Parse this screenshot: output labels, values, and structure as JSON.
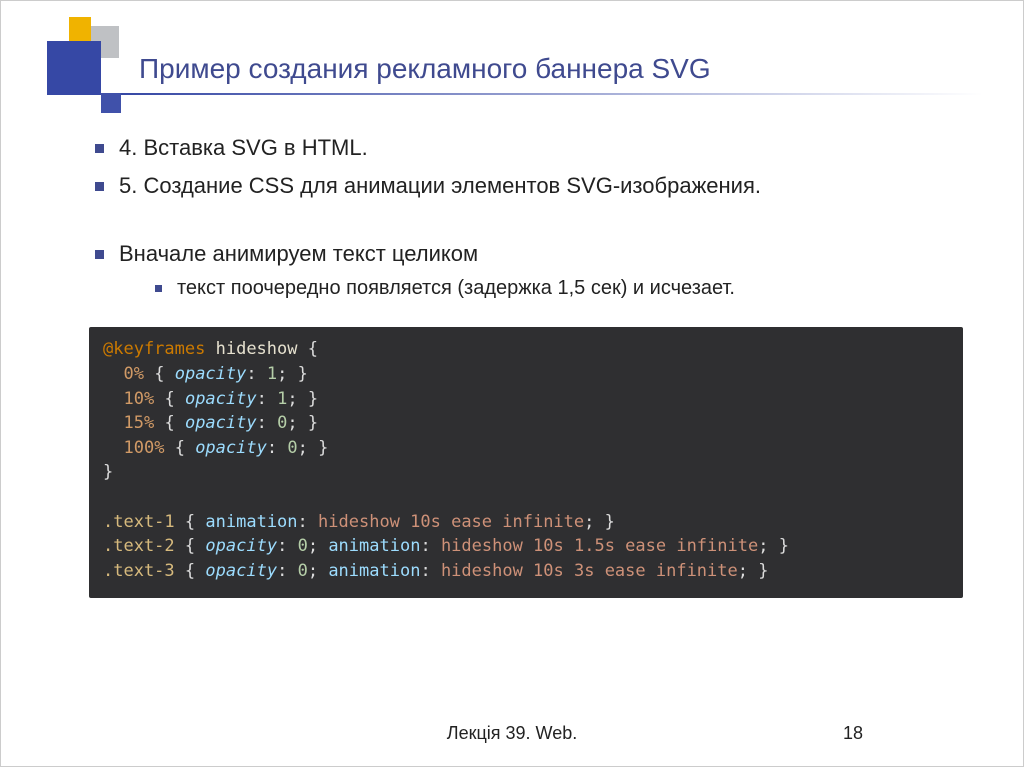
{
  "title": "Пример создания рекламного баннера SVG",
  "bullets": {
    "b1": "4. Вставка SVG в HTML.",
    "b2": "5. Создание CSS для анимации элементов SVG-изображения.",
    "b3": "Вначале анимируем текст целиком",
    "b3_sub": "текст поочередно появляется (задержка 1,5 сек) и исчезает."
  },
  "code": {
    "l1_a": "@keyframes",
    "l1_b": "hideshow",
    "l1_c": "{",
    "l2_a": "0%",
    "l2_b": "{",
    "l2_c": "opacity",
    "l2_d": ":",
    "l2_e": "1",
    "l2_f": "; }",
    "l3_a": "10%",
    "l3_e": "1",
    "l4_a": "15%",
    "l4_e": "0",
    "l5_a": "100%",
    "l5_e": "0",
    "l6": "}",
    "sel1": ".text-1",
    "sel2": ".text-2",
    "sel3": ".text-3",
    "prop_anim": "animation",
    "prop_op": "opacity",
    "valA": "hideshow 10s ease infinite",
    "valB": "hideshow 10s 1.5s ease infinite",
    "valC": "hideshow 10s 3s ease infinite",
    "zero": "0",
    "colon": ":",
    "semi": ";",
    "obr": "{",
    "cbr": "}",
    "scbr": "; }"
  },
  "footer": {
    "lecture": "Лекція 39. Web.",
    "page": "18"
  }
}
